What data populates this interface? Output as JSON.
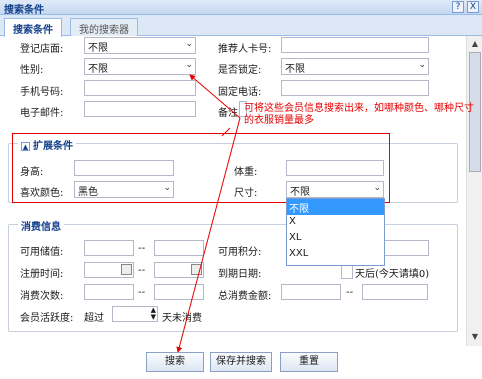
{
  "window": {
    "title": "搜索条件",
    "help": "?",
    "close": "X"
  },
  "tabs": [
    {
      "label": "搜索条件"
    },
    {
      "label": "我的搜索器"
    }
  ],
  "basic": {
    "store_label": "登记店面:",
    "store_value": "不限",
    "referrer_label": "推荐人卡号:",
    "gender_label": "性别:",
    "gender_value": "不限",
    "locked_label": "是否锁定:",
    "locked_value": "不限",
    "mobile_label": "手机号码:",
    "phone_label": "固定电话:",
    "email_label": "电子邮件:",
    "remark_label": "备注:"
  },
  "annotation": "可将这些会员信息搜索出来，如哪种颜色、哪种尺寸的衣服销量最多",
  "extended": {
    "legend": "扩展条件",
    "collapse": "▲",
    "height_label": "身高:",
    "weight_label": "体重:",
    "color_label": "喜欢颜色:",
    "color_value": "黑色",
    "size_label": "尺寸:",
    "size_value": "不限",
    "size_options": [
      "不限",
      "X",
      "XL",
      "XXL"
    ]
  },
  "consumption": {
    "legend": "消费信息",
    "balance_label": "可用储值:",
    "points_label": "可用积分:",
    "reg_time_label": "注册时间:",
    "expiry_label": "到期日期:",
    "expiry_suffix": "天后(今天请填0)",
    "count_label": "消费次数:",
    "total_label": "总消费金额:",
    "activity_label": "会员活跃度:",
    "activity_prefix": "超过",
    "activity_suffix": "天未消费",
    "range_sep": "--"
  },
  "buttons": {
    "search": "搜索",
    "save_search": "保存并搜索",
    "reset": "重置"
  },
  "colors": {
    "accent": "#15428b",
    "annotation": "#e60000",
    "highlight": "#3399ff"
  }
}
